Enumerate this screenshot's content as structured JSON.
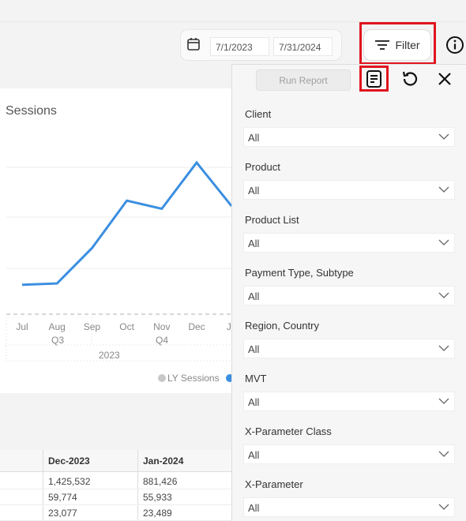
{
  "date_range": {
    "icon": "calendar-icon",
    "start": "7/1/2023",
    "end": "7/31/2024"
  },
  "filter_button": {
    "label": "Filter",
    "icon": "filter-lines-icon"
  },
  "info_icon": "info-icon",
  "chart": {
    "title": "Sessions",
    "months": [
      "Jul",
      "Aug",
      "Sep",
      "Oct",
      "Nov",
      "Dec",
      "Ja"
    ],
    "quarters": [
      "Q3",
      "Q4"
    ],
    "year": "2023",
    "legend": [
      {
        "label": "LY Sessions",
        "color": "#c8c8c8"
      },
      {
        "label": "",
        "color": "#3b8fe0"
      }
    ],
    "line_color": "#3b8fe0",
    "sessions_relative": [
      0.1,
      0.11,
      0.37,
      0.72,
      0.66,
      1.0,
      0.68
    ]
  },
  "table": {
    "columns": [
      "Dec-2023",
      "Jan-2024"
    ],
    "rows": [
      [
        "1,425,532",
        "881,426"
      ],
      [
        "59,774",
        "55,933"
      ],
      [
        "23,077",
        "23,489"
      ]
    ]
  },
  "panel": {
    "run_report": "Run Report",
    "icons": [
      "report-icon",
      "reset-icon",
      "close-icon"
    ],
    "filters": [
      {
        "label": "Client",
        "value": "All"
      },
      {
        "label": "Product",
        "value": "All"
      },
      {
        "label": "Product List",
        "value": "All"
      },
      {
        "label": "Payment Type, Subtype",
        "value": "All"
      },
      {
        "label": "Region, Country",
        "value": "All"
      },
      {
        "label": "MVT",
        "value": "All"
      },
      {
        "label": "X-Parameter Class",
        "value": "All"
      },
      {
        "label": "X-Parameter",
        "value": "All"
      }
    ]
  }
}
